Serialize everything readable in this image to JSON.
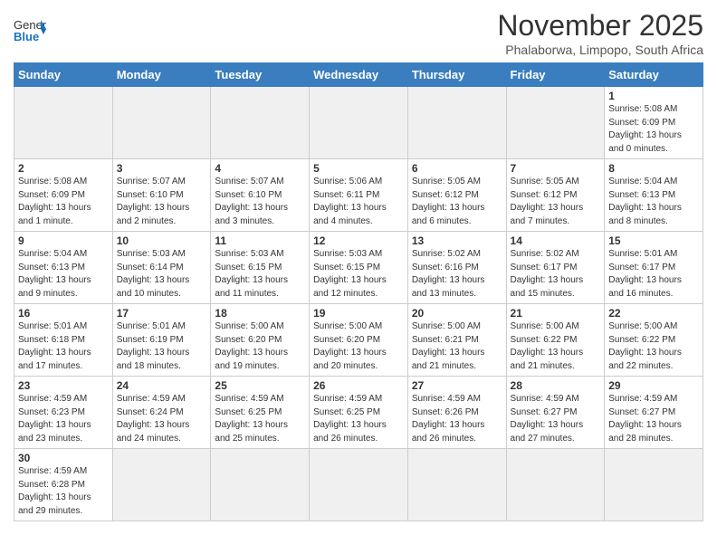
{
  "header": {
    "logo_general": "General",
    "logo_blue": "Blue",
    "month_title": "November 2025",
    "subtitle": "Phalaborwa, Limpopo, South Africa"
  },
  "days_of_week": [
    "Sunday",
    "Monday",
    "Tuesday",
    "Wednesday",
    "Thursday",
    "Friday",
    "Saturday"
  ],
  "weeks": [
    [
      {
        "day": "",
        "info": "",
        "empty": true
      },
      {
        "day": "",
        "info": "",
        "empty": true
      },
      {
        "day": "",
        "info": "",
        "empty": true
      },
      {
        "day": "",
        "info": "",
        "empty": true
      },
      {
        "day": "",
        "info": "",
        "empty": true
      },
      {
        "day": "",
        "info": "",
        "empty": true
      },
      {
        "day": "1",
        "info": "Sunrise: 5:08 AM\nSunset: 6:09 PM\nDaylight: 13 hours and 0 minutes."
      }
    ],
    [
      {
        "day": "2",
        "info": "Sunrise: 5:08 AM\nSunset: 6:09 PM\nDaylight: 13 hours and 1 minute."
      },
      {
        "day": "3",
        "info": "Sunrise: 5:07 AM\nSunset: 6:10 PM\nDaylight: 13 hours and 2 minutes."
      },
      {
        "day": "4",
        "info": "Sunrise: 5:07 AM\nSunset: 6:10 PM\nDaylight: 13 hours and 3 minutes."
      },
      {
        "day": "5",
        "info": "Sunrise: 5:06 AM\nSunset: 6:11 PM\nDaylight: 13 hours and 4 minutes."
      },
      {
        "day": "6",
        "info": "Sunrise: 5:05 AM\nSunset: 6:12 PM\nDaylight: 13 hours and 6 minutes."
      },
      {
        "day": "7",
        "info": "Sunrise: 5:05 AM\nSunset: 6:12 PM\nDaylight: 13 hours and 7 minutes."
      },
      {
        "day": "8",
        "info": "Sunrise: 5:04 AM\nSunset: 6:13 PM\nDaylight: 13 hours and 8 minutes."
      }
    ],
    [
      {
        "day": "9",
        "info": "Sunrise: 5:04 AM\nSunset: 6:13 PM\nDaylight: 13 hours and 9 minutes."
      },
      {
        "day": "10",
        "info": "Sunrise: 5:03 AM\nSunset: 6:14 PM\nDaylight: 13 hours and 10 minutes."
      },
      {
        "day": "11",
        "info": "Sunrise: 5:03 AM\nSunset: 6:15 PM\nDaylight: 13 hours and 11 minutes."
      },
      {
        "day": "12",
        "info": "Sunrise: 5:03 AM\nSunset: 6:15 PM\nDaylight: 13 hours and 12 minutes."
      },
      {
        "day": "13",
        "info": "Sunrise: 5:02 AM\nSunset: 6:16 PM\nDaylight: 13 hours and 13 minutes."
      },
      {
        "day": "14",
        "info": "Sunrise: 5:02 AM\nSunset: 6:17 PM\nDaylight: 13 hours and 15 minutes."
      },
      {
        "day": "15",
        "info": "Sunrise: 5:01 AM\nSunset: 6:17 PM\nDaylight: 13 hours and 16 minutes."
      }
    ],
    [
      {
        "day": "16",
        "info": "Sunrise: 5:01 AM\nSunset: 6:18 PM\nDaylight: 13 hours and 17 minutes."
      },
      {
        "day": "17",
        "info": "Sunrise: 5:01 AM\nSunset: 6:19 PM\nDaylight: 13 hours and 18 minutes."
      },
      {
        "day": "18",
        "info": "Sunrise: 5:00 AM\nSunset: 6:20 PM\nDaylight: 13 hours and 19 minutes."
      },
      {
        "day": "19",
        "info": "Sunrise: 5:00 AM\nSunset: 6:20 PM\nDaylight: 13 hours and 20 minutes."
      },
      {
        "day": "20",
        "info": "Sunrise: 5:00 AM\nSunset: 6:21 PM\nDaylight: 13 hours and 21 minutes."
      },
      {
        "day": "21",
        "info": "Sunrise: 5:00 AM\nSunset: 6:22 PM\nDaylight: 13 hours and 21 minutes."
      },
      {
        "day": "22",
        "info": "Sunrise: 5:00 AM\nSunset: 6:22 PM\nDaylight: 13 hours and 22 minutes."
      }
    ],
    [
      {
        "day": "23",
        "info": "Sunrise: 4:59 AM\nSunset: 6:23 PM\nDaylight: 13 hours and 23 minutes."
      },
      {
        "day": "24",
        "info": "Sunrise: 4:59 AM\nSunset: 6:24 PM\nDaylight: 13 hours and 24 minutes."
      },
      {
        "day": "25",
        "info": "Sunrise: 4:59 AM\nSunset: 6:25 PM\nDaylight: 13 hours and 25 minutes."
      },
      {
        "day": "26",
        "info": "Sunrise: 4:59 AM\nSunset: 6:25 PM\nDaylight: 13 hours and 26 minutes."
      },
      {
        "day": "27",
        "info": "Sunrise: 4:59 AM\nSunset: 6:26 PM\nDaylight: 13 hours and 26 minutes."
      },
      {
        "day": "28",
        "info": "Sunrise: 4:59 AM\nSunset: 6:27 PM\nDaylight: 13 hours and 27 minutes."
      },
      {
        "day": "29",
        "info": "Sunrise: 4:59 AM\nSunset: 6:27 PM\nDaylight: 13 hours and 28 minutes."
      }
    ],
    [
      {
        "day": "30",
        "info": "Sunrise: 4:59 AM\nSunset: 6:28 PM\nDaylight: 13 hours and 29 minutes."
      },
      {
        "day": "",
        "info": "",
        "empty": true
      },
      {
        "day": "",
        "info": "",
        "empty": true
      },
      {
        "day": "",
        "info": "",
        "empty": true
      },
      {
        "day": "",
        "info": "",
        "empty": true
      },
      {
        "day": "",
        "info": "",
        "empty": true
      },
      {
        "day": "",
        "info": "",
        "empty": true
      }
    ]
  ]
}
